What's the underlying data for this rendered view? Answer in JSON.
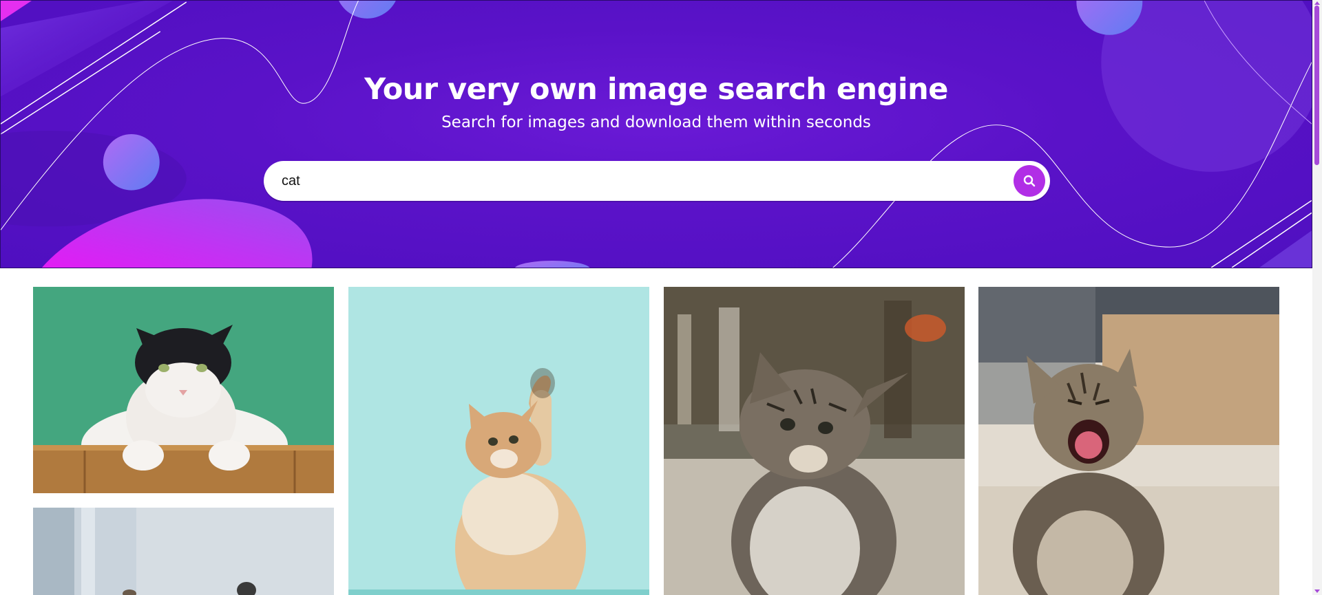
{
  "hero": {
    "title": "Your very own image search engine",
    "subtitle": "Search for images and download them within seconds",
    "accent_color": "#b12ee6",
    "background_color": "#5a12c8"
  },
  "search": {
    "value": "cat",
    "placeholder": "",
    "button_icon": "search-icon"
  },
  "gallery": {
    "images": [
      {
        "alt": "black and white cat on green background"
      },
      {
        "alt": "ginger kitten raising paw on teal background"
      },
      {
        "alt": "tabby kitten sitting"
      },
      {
        "alt": "tabby kitten yawning"
      },
      {
        "alt": "cat photo"
      }
    ]
  }
}
